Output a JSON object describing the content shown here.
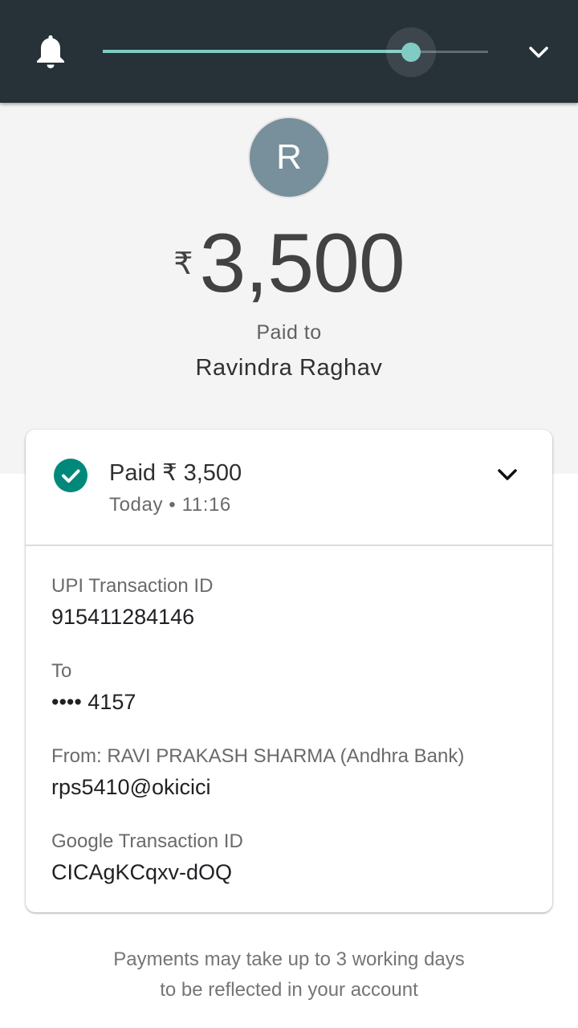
{
  "header": {
    "bell_icon": "bell-icon",
    "seek_progress": 0.8,
    "chevron_icon": "chevron-down-icon",
    "accent_color": "#80cbc4",
    "background_color": "#263238"
  },
  "payment": {
    "avatar_initial": "R",
    "avatar_color": "#78909c",
    "currency_symbol": "₹",
    "amount": "3,500",
    "paid_to_label": "Paid to",
    "payee_name": "Ravindra Raghav"
  },
  "card": {
    "status_icon": "check-circle-icon",
    "status_color": "#00897b",
    "status_title": "Paid ₹ 3,500",
    "status_time": "Today • 11:16",
    "expand_icon": "chevron-down-icon",
    "details": [
      {
        "label": "UPI Transaction ID",
        "value": "915411284146"
      },
      {
        "label": "To",
        "value": "•••• 4157"
      },
      {
        "label": "From: RAVI PRAKASH SHARMA (Andhra Bank)",
        "value": "rps5410@okicici"
      },
      {
        "label": "Google Transaction ID",
        "value": "CICAgKCqxv-dOQ"
      }
    ]
  },
  "footer": {
    "line1": "Payments may take up to 3 working days",
    "line2": "to be reflected in your account"
  }
}
